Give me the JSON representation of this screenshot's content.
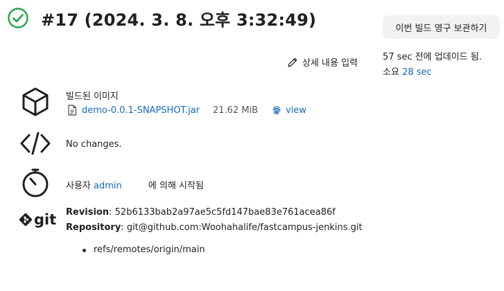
{
  "header": {
    "title": "#17 (2024. 3. 8. 오후 3:32:49)",
    "status": "success",
    "status_color": "#1ea446"
  },
  "actions": {
    "keep_build_label": "이번 빌드 영구 보관하기",
    "edit_description_label": "상세 내용 입력"
  },
  "build_info": {
    "updated": "57 sec 전에 업데이드 됨.",
    "duration_label": "소요",
    "duration_value": "28 sec"
  },
  "artifacts": {
    "heading": "빌드된 이미지",
    "file_name": "demo-0.0.1-SNAPSHOT.jar",
    "file_size": "21.62 MiB",
    "view_label": "view"
  },
  "changes": {
    "text": "No changes."
  },
  "cause": {
    "prefix": "사용자",
    "user": "admin",
    "suffix": "에 의해 시작됨"
  },
  "git": {
    "logo_text": "git",
    "revision_label": "Revision",
    "revision": "52b6133bab2a97ae5c5fd147bae83e761acea86f",
    "repository_label": "Repository",
    "repository": "git@github.com:Woohahalife/fastcampus-jenkins.git",
    "branches": [
      "refs/remotes/origin/main"
    ]
  },
  "icons": {
    "status": "check-circle-icon",
    "edit": "pencil-icon",
    "artifacts": "package-icon",
    "file": "file-icon",
    "fingerprint": "fingerprint-icon",
    "changes": "code-icon",
    "cause": "timer-icon",
    "git": "git-logo-icon"
  },
  "colors": {
    "link": "#1368c4",
    "text": "#1f1f1f",
    "button_bg": "#f2f2f2"
  }
}
